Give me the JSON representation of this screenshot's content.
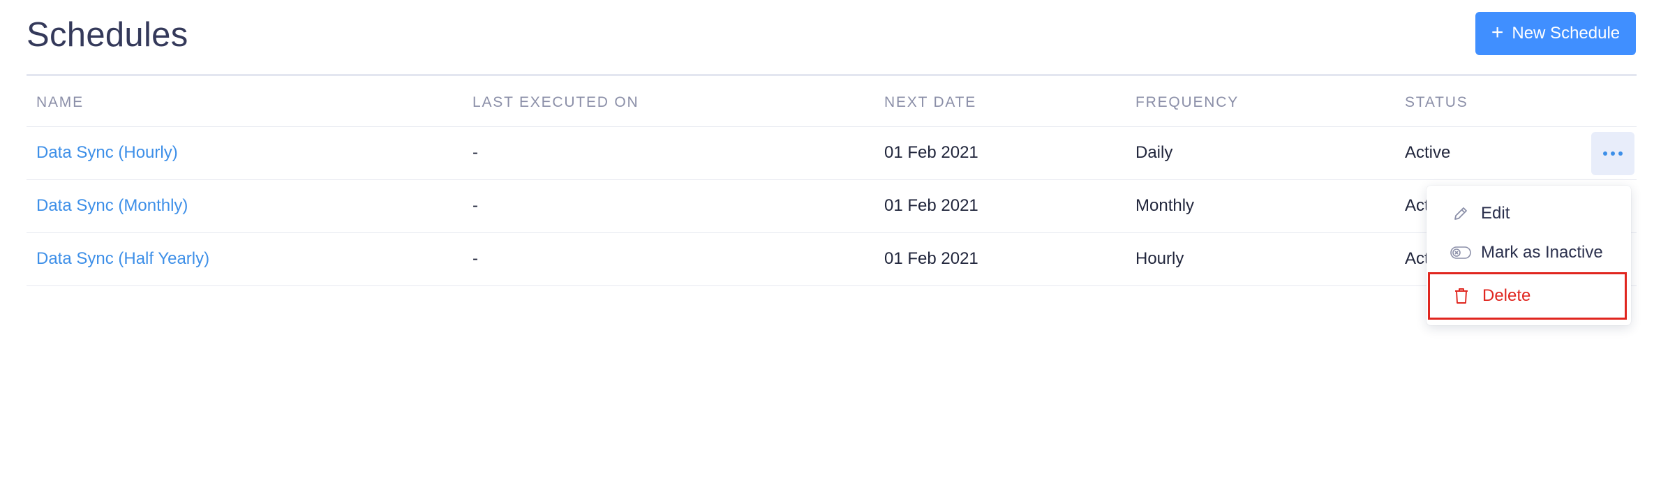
{
  "header": {
    "title": "Schedules",
    "new_button_label": "New Schedule",
    "new_button_icon": "plus-icon"
  },
  "table": {
    "columns": [
      "NAME",
      "LAST EXECUTED ON",
      "NEXT DATE",
      "FREQUENCY",
      "STATUS"
    ],
    "rows": [
      {
        "name": "Data Sync (Hourly)",
        "last_executed": "-",
        "next_date": "01 Feb 2021",
        "frequency": "Daily",
        "status": "Active"
      },
      {
        "name": "Data Sync (Monthly)",
        "last_executed": "-",
        "next_date": "01 Feb 2021",
        "frequency": "Monthly",
        "status": "Active"
      },
      {
        "name": "Data Sync (Half Yearly)",
        "last_executed": "-",
        "next_date": "01 Feb 2021",
        "frequency": "Hourly",
        "status": "Active"
      }
    ],
    "row_action_icon": "more-horizontal-icon"
  },
  "context_menu": {
    "items": [
      {
        "label": "Edit",
        "icon": "pencil-icon"
      },
      {
        "label": "Mark as Inactive",
        "icon": "toggle-off-icon"
      },
      {
        "label": "Delete",
        "icon": "trash-icon"
      }
    ]
  },
  "colors": {
    "accent": "#408fff",
    "link": "#3d8fe8",
    "danger": "#e0261f",
    "header_text": "#8b8fa8"
  }
}
